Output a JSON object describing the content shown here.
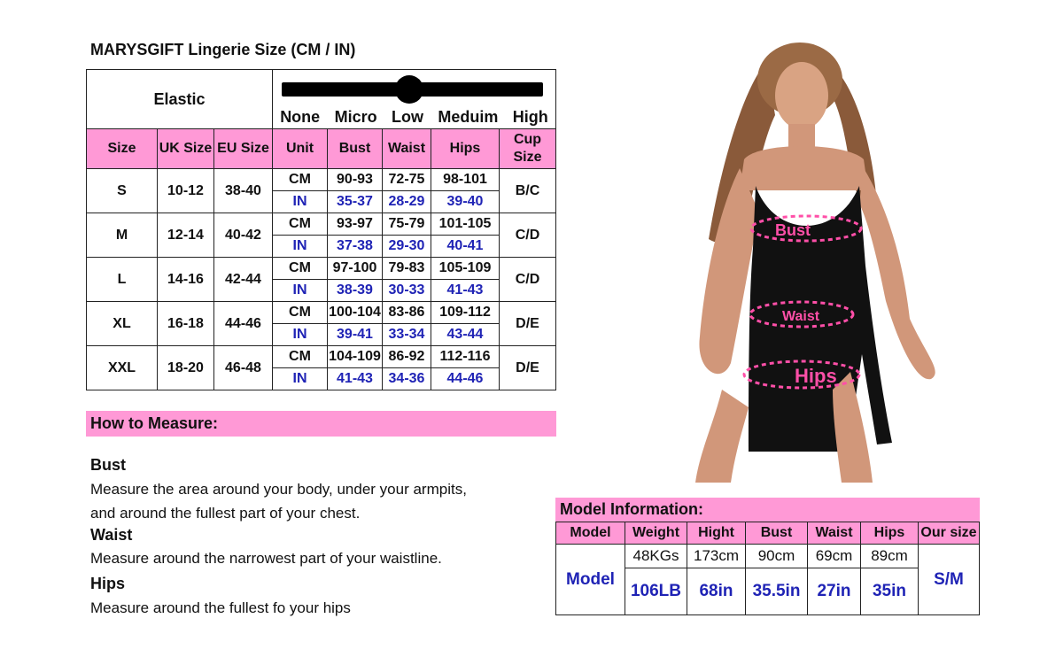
{
  "title": "MARYSGIFT Lingerie Size (CM / IN)",
  "elastic": {
    "label": "Elastic",
    "levels": [
      "None",
      "Micro",
      "Low",
      "Meduim",
      "High"
    ]
  },
  "size_table": {
    "headers": [
      "Size",
      "UK Size",
      "EU Size",
      "Unit",
      "Bust",
      "Waist",
      "Hips",
      "Cup Size"
    ],
    "rows": [
      {
        "size": "S",
        "uk": "10-12",
        "eu": "38-40",
        "cm_unit": "CM",
        "in_unit": "IN",
        "bust_cm": "90-93",
        "waist_cm": "72-75",
        "hips_cm": "98-101",
        "bust_in": "35-37",
        "waist_in": "28-29",
        "hips_in": "39-40",
        "cup": "B/C"
      },
      {
        "size": "M",
        "uk": "12-14",
        "eu": "40-42",
        "cm_unit": "CM",
        "in_unit": "IN",
        "bust_cm": "93-97",
        "waist_cm": "75-79",
        "hips_cm": "101-105",
        "bust_in": "37-38",
        "waist_in": "29-30",
        "hips_in": "40-41",
        "cup": "C/D"
      },
      {
        "size": "L",
        "uk": "14-16",
        "eu": "42-44",
        "cm_unit": "CM",
        "in_unit": "IN",
        "bust_cm": "97-100",
        "waist_cm": "79-83",
        "hips_cm": "105-109",
        "bust_in": "38-39",
        "waist_in": "30-33",
        "hips_in": "41-43",
        "cup": "C/D"
      },
      {
        "size": "XL",
        "uk": "16-18",
        "eu": "44-46",
        "cm_unit": "CM",
        "in_unit": "IN",
        "bust_cm": "100-104",
        "waist_cm": "83-86",
        "hips_cm": "109-112",
        "bust_in": "39-41",
        "waist_in": "33-34",
        "hips_in": "43-44",
        "cup": "D/E"
      },
      {
        "size": "XXL",
        "uk": "18-20",
        "eu": "46-48",
        "cm_unit": "CM",
        "in_unit": "IN",
        "bust_cm": "104-109",
        "waist_cm": "86-92",
        "hips_cm": "112-116",
        "bust_in": "41-43",
        "waist_in": "34-36",
        "hips_in": "44-46",
        "cup": "D/E"
      }
    ]
  },
  "how_to_measure": {
    "title": "How to Measure:",
    "bust_title": "Bust",
    "bust_line1": "Measure the area around your body, under your armpits,",
    "bust_line2": "and around the fullest part of your chest.",
    "waist_title": "Waist",
    "waist_text": "Measure around the narrowest part of your waistline.",
    "hips_title": "Hips",
    "hips_text": "Measure around the fullest fo your hips"
  },
  "photo_labels": {
    "bust": "Bust",
    "waist": "Waist",
    "hips": "Hips"
  },
  "model_info": {
    "title": "Model Information:",
    "headers": [
      "Model",
      "Weight",
      "Hight",
      "Bust",
      "Waist",
      "Hips",
      "Our size"
    ],
    "label": "Model",
    "metric": [
      "48KGs",
      "173cm",
      "90cm",
      "69cm",
      "89cm"
    ],
    "imperial": [
      "106LB",
      "68in",
      "35.5in",
      "27in",
      "35in"
    ],
    "our_size": "S/M"
  },
  "colors": {
    "accent_pink": "#ff99d6",
    "inch_blue": "#1f23b5",
    "arrow_pink": "#ff4fa8"
  }
}
